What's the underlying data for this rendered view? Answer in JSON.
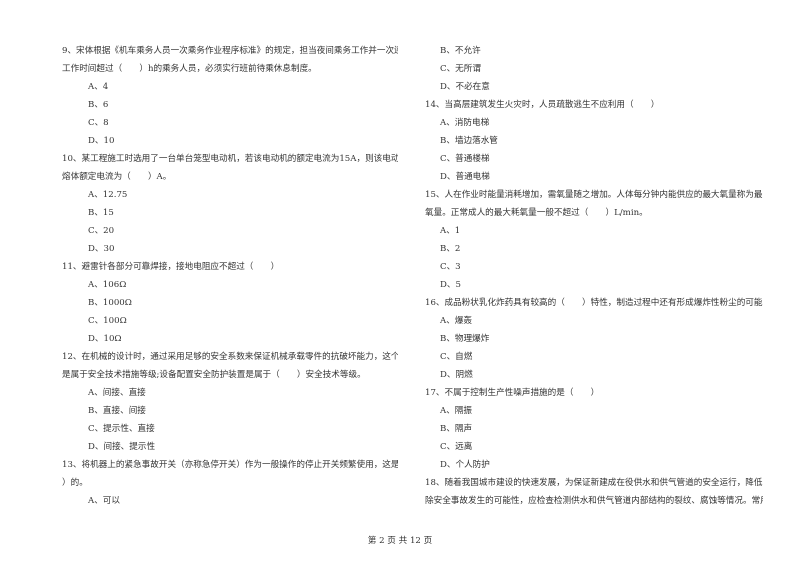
{
  "left_column": [
    {
      "text": "9、宋体根据《机车乘务人员一次乘务作业程序标准》的规定，担当夜间乘务工作并一次连续",
      "type": "question"
    },
    {
      "text": "工作时间超过（　　）h的乘务人员，必须实行班前待乘休息制度。",
      "type": "question"
    },
    {
      "text": "A、4",
      "type": "option"
    },
    {
      "text": "B、6",
      "type": "option"
    },
    {
      "text": "C、8",
      "type": "option"
    },
    {
      "text": "D、10",
      "type": "option"
    },
    {
      "text": "10、某工程施工时选用了一台单台笼型电动机，若该电动机的额定电流为15A，则该电动机的",
      "type": "question"
    },
    {
      "text": "熔体额定电流为（　　）A。",
      "type": "question"
    },
    {
      "text": "A、12.75",
      "type": "option"
    },
    {
      "text": "B、15",
      "type": "option"
    },
    {
      "text": "C、20",
      "type": "option"
    },
    {
      "text": "D、30",
      "type": "option"
    },
    {
      "text": "11、避雷针各部分可靠焊接，接地电阻应不超过（　　）",
      "type": "question"
    },
    {
      "text": "A、106Ω",
      "type": "option"
    },
    {
      "text": "B、1000Ω",
      "type": "option"
    },
    {
      "text": "C、100Ω",
      "type": "option"
    },
    {
      "text": "D、10Ω",
      "type": "option"
    },
    {
      "text": "12、在机械的设计时，通过采用足够的安全系数来保证机械承载零件的抗破坏能力，这个措施",
      "type": "question"
    },
    {
      "text": "是属于安全技术措施等级;设备配置安全防护装置是属于（　　）安全技术等级。",
      "type": "question"
    },
    {
      "text": "A、间接、直接",
      "type": "option"
    },
    {
      "text": "B、直接、间接",
      "type": "option"
    },
    {
      "text": "C、提示性、直接",
      "type": "option"
    },
    {
      "text": "D、间接、提示性",
      "type": "option"
    },
    {
      "text": "13、将机器上的紧急事故开关（亦称急停开关）作为一般操作的停止开关频繁使用，这是（",
      "type": "question"
    },
    {
      "text": "）的。",
      "type": "question"
    },
    {
      "text": "A、可以",
      "type": "option"
    }
  ],
  "right_column": [
    {
      "text": "B、不允许",
      "type": "option"
    },
    {
      "text": "C、无所谓",
      "type": "option"
    },
    {
      "text": "D、不必在意",
      "type": "option"
    },
    {
      "text": "14、当高层建筑发生火灾时，人员疏散逃生不应利用（　　）",
      "type": "question"
    },
    {
      "text": "A、消防电梯",
      "type": "option"
    },
    {
      "text": "B、墙边落水管",
      "type": "option"
    },
    {
      "text": "C、普通楼梯",
      "type": "option"
    },
    {
      "text": "D、普通电梯",
      "type": "option"
    },
    {
      "text": "15、人在作业时能量消耗增加，需氧量随之增加。人体每分钟内能供应的最大氧量称为最大耗",
      "type": "question"
    },
    {
      "text": "氧量。正常成人的最大耗氧量一般不超过（　　）L/min。",
      "type": "question"
    },
    {
      "text": "A、1",
      "type": "option"
    },
    {
      "text": "B、2",
      "type": "option"
    },
    {
      "text": "C、3",
      "type": "option"
    },
    {
      "text": "D、5",
      "type": "option"
    },
    {
      "text": "16、成品粉状乳化炸药具有较高的（　　）特性，制造过程中还有形成爆炸性粉尘的可能。",
      "type": "question"
    },
    {
      "text": "A、爆轰",
      "type": "option"
    },
    {
      "text": "B、物理爆炸",
      "type": "option"
    },
    {
      "text": "C、自燃",
      "type": "option"
    },
    {
      "text": "D、阴燃",
      "type": "option"
    },
    {
      "text": "17、不属于控制生产性噪声措施的是（　　）",
      "type": "question"
    },
    {
      "text": "A、隔振",
      "type": "option"
    },
    {
      "text": "B、隔声",
      "type": "option"
    },
    {
      "text": "C、远离",
      "type": "option"
    },
    {
      "text": "D、个人防护",
      "type": "option"
    },
    {
      "text": "18、随着我国城市建设的快速发展，为保证新建成在役供水和供气管道的安全运行，降低或消",
      "type": "question"
    },
    {
      "text": "除安全事故发生的可能性，应检查检测供水和供气管道内部结构的裂纹、腐蚀等情况。常用的",
      "type": "question"
    }
  ],
  "footer": {
    "page_label": "第 2 页 共 12 页"
  }
}
